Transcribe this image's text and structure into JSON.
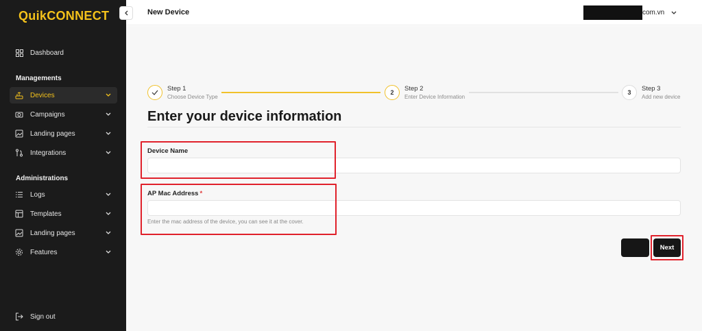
{
  "brand": {
    "name": "QuikCONNECT",
    "accent": "#f4c21b"
  },
  "sidebar": {
    "dashboard": {
      "label": "Dashboard",
      "icon": "grid-icon"
    },
    "managements_title": "Managements",
    "managements": [
      {
        "label": "Devices",
        "icon": "router-icon",
        "active": true
      },
      {
        "label": "Campaigns",
        "icon": "camera-icon"
      },
      {
        "label": "Landing pages",
        "icon": "image-icon"
      },
      {
        "label": "Integrations",
        "icon": "git-icon"
      }
    ],
    "administrations_title": "Administrations",
    "administrations": [
      {
        "label": "Logs",
        "icon": "list-icon"
      },
      {
        "label": "Templates",
        "icon": "template-icon"
      },
      {
        "label": "Landing pages",
        "icon": "image-icon"
      },
      {
        "label": "Features",
        "icon": "gear-icon"
      }
    ],
    "sign_out": "Sign out"
  },
  "header": {
    "title": "New Device",
    "account_domain": "com.vn"
  },
  "stepper": [
    {
      "number": "1",
      "title": "Step 1",
      "subtitle": "Choose Device Type",
      "state": "done"
    },
    {
      "number": "2",
      "title": "Step 2",
      "subtitle": "Enter Device Information",
      "state": "current"
    },
    {
      "number": "3",
      "title": "Step 3",
      "subtitle": "Add new device",
      "state": "todo"
    }
  ],
  "form": {
    "title": "Enter your device information",
    "device_name": {
      "label": "Device Name",
      "value": "",
      "placeholder": ""
    },
    "mac_address": {
      "label": "AP Mac Address",
      "required_mark": "*",
      "value": "",
      "placeholder": "",
      "hint": "Enter the mac address of the device, you can see it at the cover."
    },
    "back_label": "",
    "next_label": "Next"
  },
  "colors": {
    "highlight": "#e0202a",
    "step_active": "#f0c12a",
    "sidebar_bg": "#1b1b1b"
  }
}
